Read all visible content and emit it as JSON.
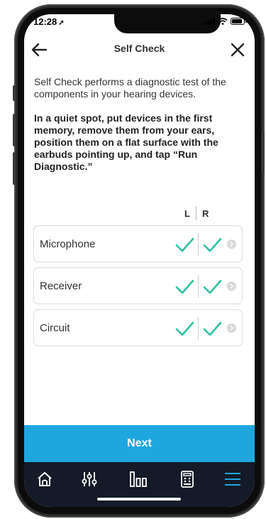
{
  "status_bar": {
    "time": "12:28",
    "location_glyph": "➚"
  },
  "header": {
    "title": "Self Check"
  },
  "content": {
    "intro": "Self Check performs a diagnostic test of the components in your hearing devices.",
    "instructions": "In a quiet spot, put devices in the first memory, remove them from your ears, position them on a flat surface with the earbuds pointing up, and tap “Run Diagnostic.”",
    "column_left": "L",
    "column_right": "R"
  },
  "checks": [
    {
      "label": "Microphone",
      "left": "pass",
      "right": "pass"
    },
    {
      "label": "Receiver",
      "left": "pass",
      "right": "pass"
    },
    {
      "label": "Circuit",
      "left": "pass",
      "right": "pass"
    }
  ],
  "next_button": {
    "label": "Next"
  },
  "tabbar": {
    "items": [
      "home-icon",
      "sliders-icon",
      "bars-icon",
      "remote-icon",
      "menu-icon"
    ],
    "active_index": 4
  },
  "colors": {
    "accent": "#1ea7df",
    "check": "#2fbfa0",
    "tabbar": "#141a27"
  }
}
